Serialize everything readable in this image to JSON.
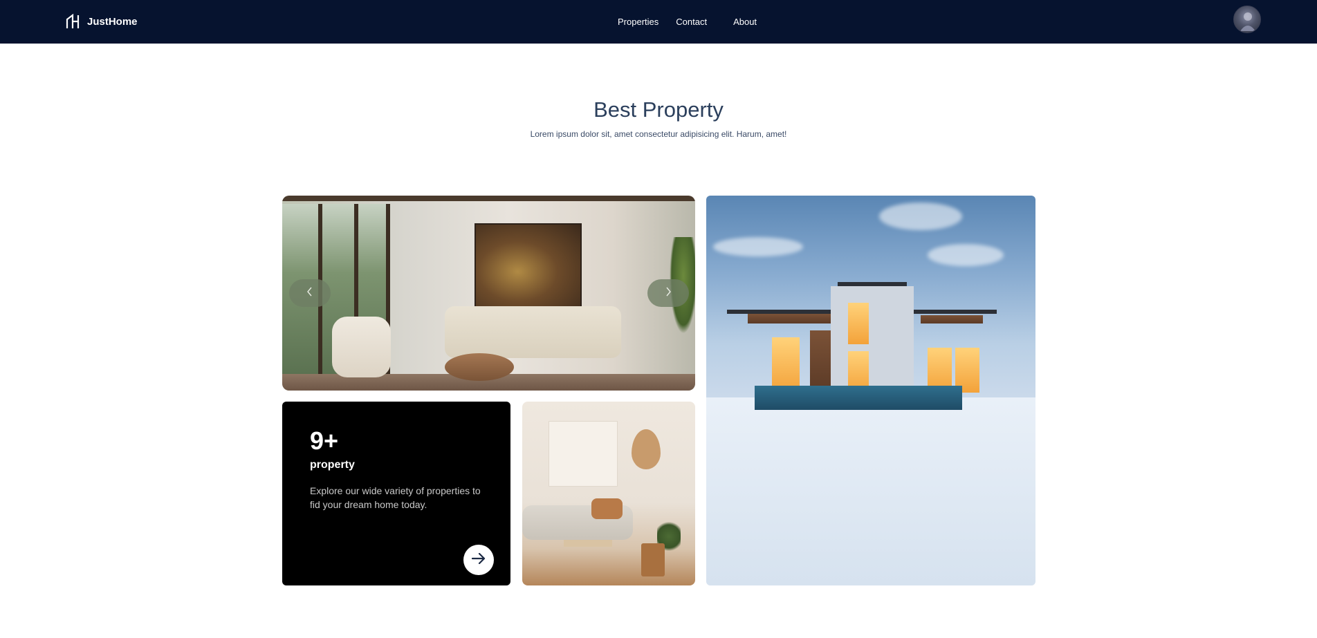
{
  "navbar": {
    "brand": "JustHome",
    "links": [
      {
        "label": "Properties"
      },
      {
        "label": "Contact"
      },
      {
        "label": "About"
      }
    ]
  },
  "hero": {
    "title": "Best Property",
    "subtitle": "Lorem ipsum dolor sit, amet consectetur adipisicing elit. Harum, amet!"
  },
  "stat_card": {
    "number": "9+",
    "label": "property",
    "description": "Explore our wide variety of properties to fid your dream home today."
  },
  "colors": {
    "navbar_bg": "#06132f",
    "title": "#2b3f5c",
    "stat_card_bg": "#000000"
  },
  "icons": {
    "brand": "house-logo-icon",
    "prev": "chevron-left-icon",
    "next": "chevron-right-icon",
    "go": "arrow-right-icon"
  }
}
